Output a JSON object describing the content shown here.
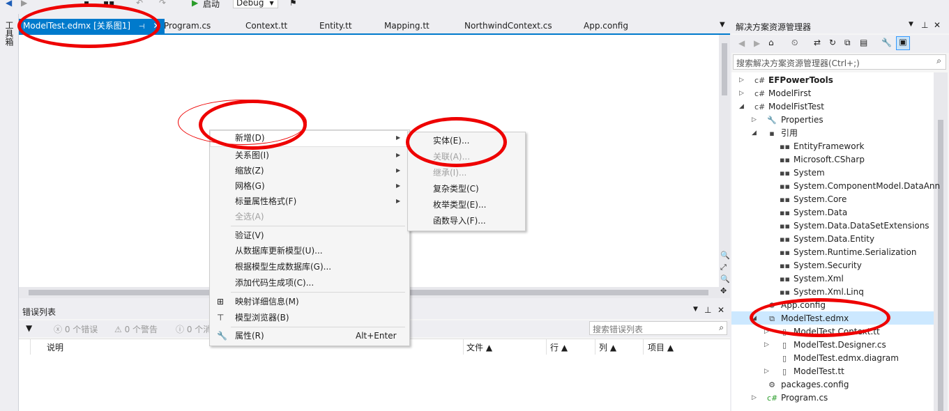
{
  "toolbar": {
    "start_label": "启动",
    "config_value": "Debug"
  },
  "left_strip": {
    "label": "工具箱"
  },
  "tabs": [
    {
      "label": "ModelTest.edmx [关系图1]",
      "active": true
    },
    {
      "label": "Program.cs"
    },
    {
      "label": "Context.tt"
    },
    {
      "label": "Entity.tt"
    },
    {
      "label": "Mapping.tt"
    },
    {
      "label": "NorthwindContext.cs"
    },
    {
      "label": "App.config"
    }
  ],
  "context_menu": {
    "items": [
      {
        "label": "新增(D)",
        "submenu": true
      },
      {
        "label": "关系图(I)",
        "submenu": true
      },
      {
        "label": "缩放(Z)",
        "submenu": true
      },
      {
        "label": "网格(G)",
        "submenu": true
      },
      {
        "label": "标量属性格式(F)",
        "submenu": true
      },
      {
        "label": "全选(A)",
        "disabled": true
      },
      {
        "label": "验证(V)"
      },
      {
        "label": "从数据库更新模型(U)..."
      },
      {
        "label": "根据模型生成数据库(G)..."
      },
      {
        "label": "添加代码生成项(C)..."
      },
      {
        "label": "映射详细信息(M)"
      },
      {
        "label": "模型浏览器(B)"
      },
      {
        "label": "属性(R)",
        "shortcut": "Alt+Enter"
      }
    ]
  },
  "submenu": {
    "items": [
      {
        "label": "实体(E)..."
      },
      {
        "label": "关联(A)...",
        "disabled": true
      },
      {
        "label": "继承(I)...",
        "disabled": true
      },
      {
        "label": "复杂类型(C)"
      },
      {
        "label": "枚举类型(E)..."
      },
      {
        "label": "函数导入(F)..."
      }
    ]
  },
  "error_list": {
    "title": "错误列表",
    "errors": "0 个错误",
    "warnings": "0 个警告",
    "messages": "0 个消",
    "search_placeholder": "搜索错误列表",
    "columns": [
      "说明",
      "文件",
      "行",
      "列",
      "项目"
    ]
  },
  "solution_explorer": {
    "title": "解决方案资源管理器",
    "search_placeholder": "搜索解决方案资源管理器(Ctrl+;)",
    "tree": [
      {
        "label": "EFPowerTools",
        "bold": true
      },
      {
        "label": "ModelFirst"
      },
      {
        "label": "ModelFistTest"
      },
      {
        "label": "Properties"
      },
      {
        "label": "引用"
      },
      {
        "label": "EntityFramework"
      },
      {
        "label": "Microsoft.CSharp"
      },
      {
        "label": "System"
      },
      {
        "label": "System.ComponentModel.DataAnn"
      },
      {
        "label": "System.Core"
      },
      {
        "label": "System.Data"
      },
      {
        "label": "System.Data.DataSetExtensions"
      },
      {
        "label": "System.Data.Entity"
      },
      {
        "label": "System.Runtime.Serialization"
      },
      {
        "label": "System.Security"
      },
      {
        "label": "System.Xml"
      },
      {
        "label": "System.Xml.Linq"
      },
      {
        "label": "App.config"
      },
      {
        "label": "ModelTest.edmx",
        "selected": true
      },
      {
        "label": "ModelTest.Context.tt"
      },
      {
        "label": "ModelTest.Designer.cs"
      },
      {
        "label": "ModelTest.edmx.diagram"
      },
      {
        "label": "ModelTest.tt"
      },
      {
        "label": "packages.config"
      },
      {
        "label": "Program.cs"
      }
    ]
  },
  "colors": {
    "accent": "#007acc",
    "annotation": "#e00000"
  }
}
